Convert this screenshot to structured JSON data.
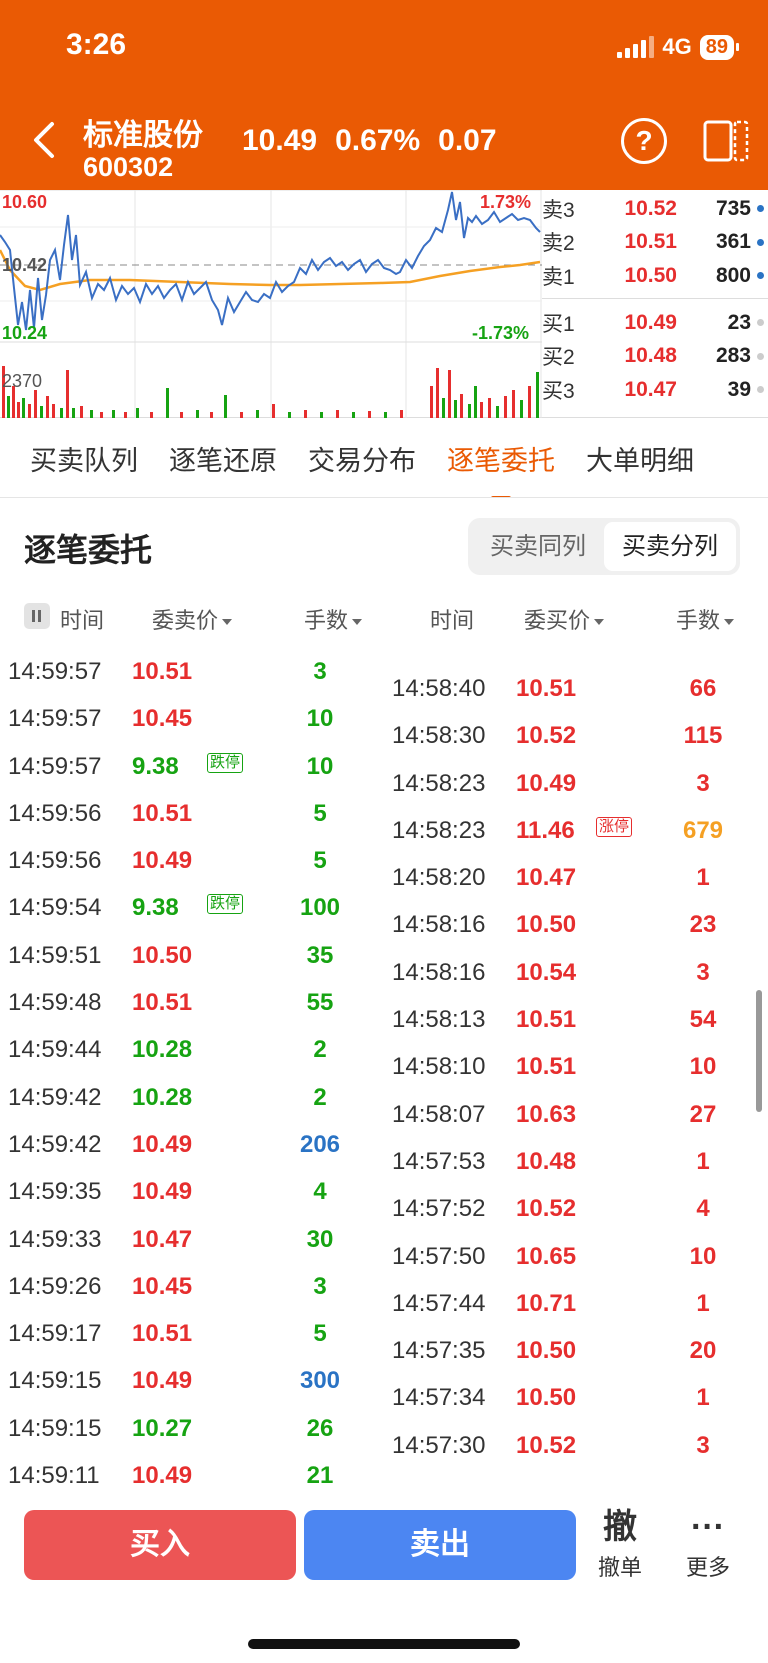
{
  "status": {
    "time": "3:26",
    "network": "4G",
    "battery": "89"
  },
  "header": {
    "stock_name": "标准股份",
    "stock_code": "600302",
    "price": "10.49",
    "change_pct": "0.67%",
    "change": "0.07"
  },
  "chart": {
    "high_price": "10.60",
    "mid_price": "10.42",
    "low_price": "10.24",
    "high_pct": "1.73%",
    "low_pct": "-1.73%",
    "volume_label": "2370"
  },
  "order_book": {
    "sell": [
      {
        "name": "卖3",
        "price": "10.52",
        "qty": "735"
      },
      {
        "name": "卖2",
        "price": "10.51",
        "qty": "361"
      },
      {
        "name": "卖1",
        "price": "10.50",
        "qty": "800"
      }
    ],
    "buy": [
      {
        "name": "买1",
        "price": "10.49",
        "qty": "23"
      },
      {
        "name": "买2",
        "price": "10.48",
        "qty": "283"
      },
      {
        "name": "买3",
        "price": "10.47",
        "qty": "39"
      }
    ]
  },
  "tabs": [
    "买卖队列",
    "逐笔还原",
    "交易分布",
    "逐笔委托",
    "大单明细"
  ],
  "section": {
    "title": "逐笔委托",
    "seg_left": "买卖同列",
    "seg_right": "买卖分列"
  },
  "columns": {
    "time": "时间",
    "sell_price": "委卖价",
    "qty": "手数",
    "time2": "时间",
    "buy_price": "委买价",
    "qty2": "手数"
  },
  "colors": {
    "accent": "#ea5a04",
    "up": "#e62e2e",
    "down": "#16a312",
    "blue": "#2a73c4",
    "orange": "#f5a023"
  },
  "left_rows": [
    {
      "time": "14:59:57",
      "price": "10.51",
      "pc": "red",
      "qty": "3",
      "qc": "green"
    },
    {
      "time": "14:59:57",
      "price": "10.45",
      "pc": "red",
      "qty": "10",
      "qc": "green"
    },
    {
      "time": "14:59:57",
      "price": "9.38",
      "pc": "green",
      "flag": "跌停",
      "qty": "10",
      "qc": "green"
    },
    {
      "time": "14:59:56",
      "price": "10.51",
      "pc": "red",
      "qty": "5",
      "qc": "green"
    },
    {
      "time": "14:59:56",
      "price": "10.49",
      "pc": "red",
      "qty": "5",
      "qc": "green"
    },
    {
      "time": "14:59:54",
      "price": "9.38",
      "pc": "green",
      "flag": "跌停",
      "qty": "100",
      "qc": "green"
    },
    {
      "time": "14:59:51",
      "price": "10.50",
      "pc": "red",
      "qty": "35",
      "qc": "green"
    },
    {
      "time": "14:59:48",
      "price": "10.51",
      "pc": "red",
      "qty": "55",
      "qc": "green"
    },
    {
      "time": "14:59:44",
      "price": "10.28",
      "pc": "green",
      "qty": "2",
      "qc": "green"
    },
    {
      "time": "14:59:42",
      "price": "10.28",
      "pc": "green",
      "qty": "2",
      "qc": "green"
    },
    {
      "time": "14:59:42",
      "price": "10.49",
      "pc": "red",
      "qty": "206",
      "qc": "blue"
    },
    {
      "time": "14:59:35",
      "price": "10.49",
      "pc": "red",
      "qty": "4",
      "qc": "green"
    },
    {
      "time": "14:59:33",
      "price": "10.47",
      "pc": "red",
      "qty": "30",
      "qc": "green"
    },
    {
      "time": "14:59:26",
      "price": "10.45",
      "pc": "red",
      "qty": "3",
      "qc": "green"
    },
    {
      "time": "14:59:17",
      "price": "10.51",
      "pc": "red",
      "qty": "5",
      "qc": "green"
    },
    {
      "time": "14:59:15",
      "price": "10.49",
      "pc": "red",
      "qty": "300",
      "qc": "blue"
    },
    {
      "time": "14:59:15",
      "price": "10.27",
      "pc": "green",
      "qty": "26",
      "qc": "green"
    },
    {
      "time": "14:59:11",
      "price": "10.49",
      "pc": "red",
      "qty": "21",
      "qc": "green"
    }
  ],
  "right_rows": [
    {
      "time": "14:58:40",
      "price": "10.51",
      "pc": "red",
      "qty": "66",
      "qc": "red"
    },
    {
      "time": "14:58:30",
      "price": "10.52",
      "pc": "red",
      "qty": "115",
      "qc": "red"
    },
    {
      "time": "14:58:23",
      "price": "10.49",
      "pc": "red",
      "qty": "3",
      "qc": "red"
    },
    {
      "time": "14:58:23",
      "price": "11.46",
      "pc": "red",
      "flag": "涨停",
      "qty": "679",
      "qc": "orange"
    },
    {
      "time": "14:58:20",
      "price": "10.47",
      "pc": "red",
      "qty": "1",
      "qc": "red"
    },
    {
      "time": "14:58:16",
      "price": "10.50",
      "pc": "red",
      "qty": "23",
      "qc": "red"
    },
    {
      "time": "14:58:16",
      "price": "10.54",
      "pc": "red",
      "qty": "3",
      "qc": "red"
    },
    {
      "time": "14:58:13",
      "price": "10.51",
      "pc": "red",
      "qty": "54",
      "qc": "red"
    },
    {
      "time": "14:58:10",
      "price": "10.51",
      "pc": "red",
      "qty": "10",
      "qc": "red"
    },
    {
      "time": "14:58:07",
      "price": "10.63",
      "pc": "red",
      "qty": "27",
      "qc": "red"
    },
    {
      "time": "14:57:53",
      "price": "10.48",
      "pc": "red",
      "qty": "1",
      "qc": "red"
    },
    {
      "time": "14:57:52",
      "price": "10.52",
      "pc": "red",
      "qty": "4",
      "qc": "red"
    },
    {
      "time": "14:57:50",
      "price": "10.65",
      "pc": "red",
      "qty": "10",
      "qc": "red"
    },
    {
      "time": "14:57:44",
      "price": "10.71",
      "pc": "red",
      "qty": "1",
      "qc": "red"
    },
    {
      "time": "14:57:35",
      "price": "10.50",
      "pc": "red",
      "qty": "20",
      "qc": "red"
    },
    {
      "time": "14:57:34",
      "price": "10.50",
      "pc": "red",
      "qty": "1",
      "qc": "red"
    },
    {
      "time": "14:57:30",
      "price": "10.52",
      "pc": "red",
      "qty": "3",
      "qc": "red"
    }
  ],
  "bottom": {
    "buy": "买入",
    "sell": "卖出",
    "cancel_icon": "撤",
    "cancel": "撤单",
    "more_icon": "···",
    "more": "更多"
  }
}
